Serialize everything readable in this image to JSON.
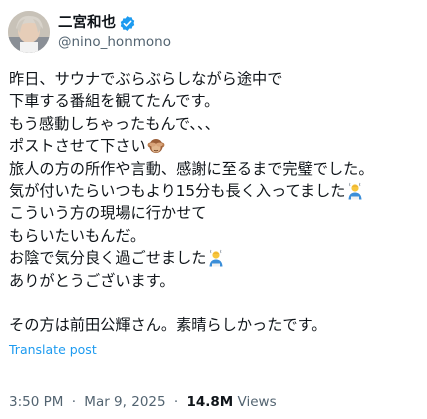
{
  "author": {
    "display_name": "二宮和也",
    "handle": "@nino_honmono",
    "verified_color": "#1d9bf0"
  },
  "tweet": {
    "lines": [
      "昨日、サウナでぶらぶらしながら途中で",
      "下車する番組を観てたんです。",
      "もう感動しちゃったもんで、、、",
      "ポストさせて下さい",
      "旅人の方の所作や言動、感謝に至るまで完璧でした。",
      "気が付いたらいつもより15分も長く入ってました",
      "こういう方の現場に行かせて",
      "もらいたいもんだ。",
      "お陰で気分良く過ごせました",
      "ありがとうございます。",
      "",
      "その方は前田公輝さん。素晴らしかったです。"
    ],
    "emojis": {
      "line_3": "see-no-evil-monkey-icon",
      "line_5": "person-in-sauna-icon",
      "line_8": "person-in-sauna-icon"
    }
  },
  "translate_label": "Translate post",
  "meta": {
    "time": "3:50 PM",
    "separator": "·",
    "date": "Mar 9, 2025",
    "views_count": "14.8M",
    "views_label": "Views"
  }
}
